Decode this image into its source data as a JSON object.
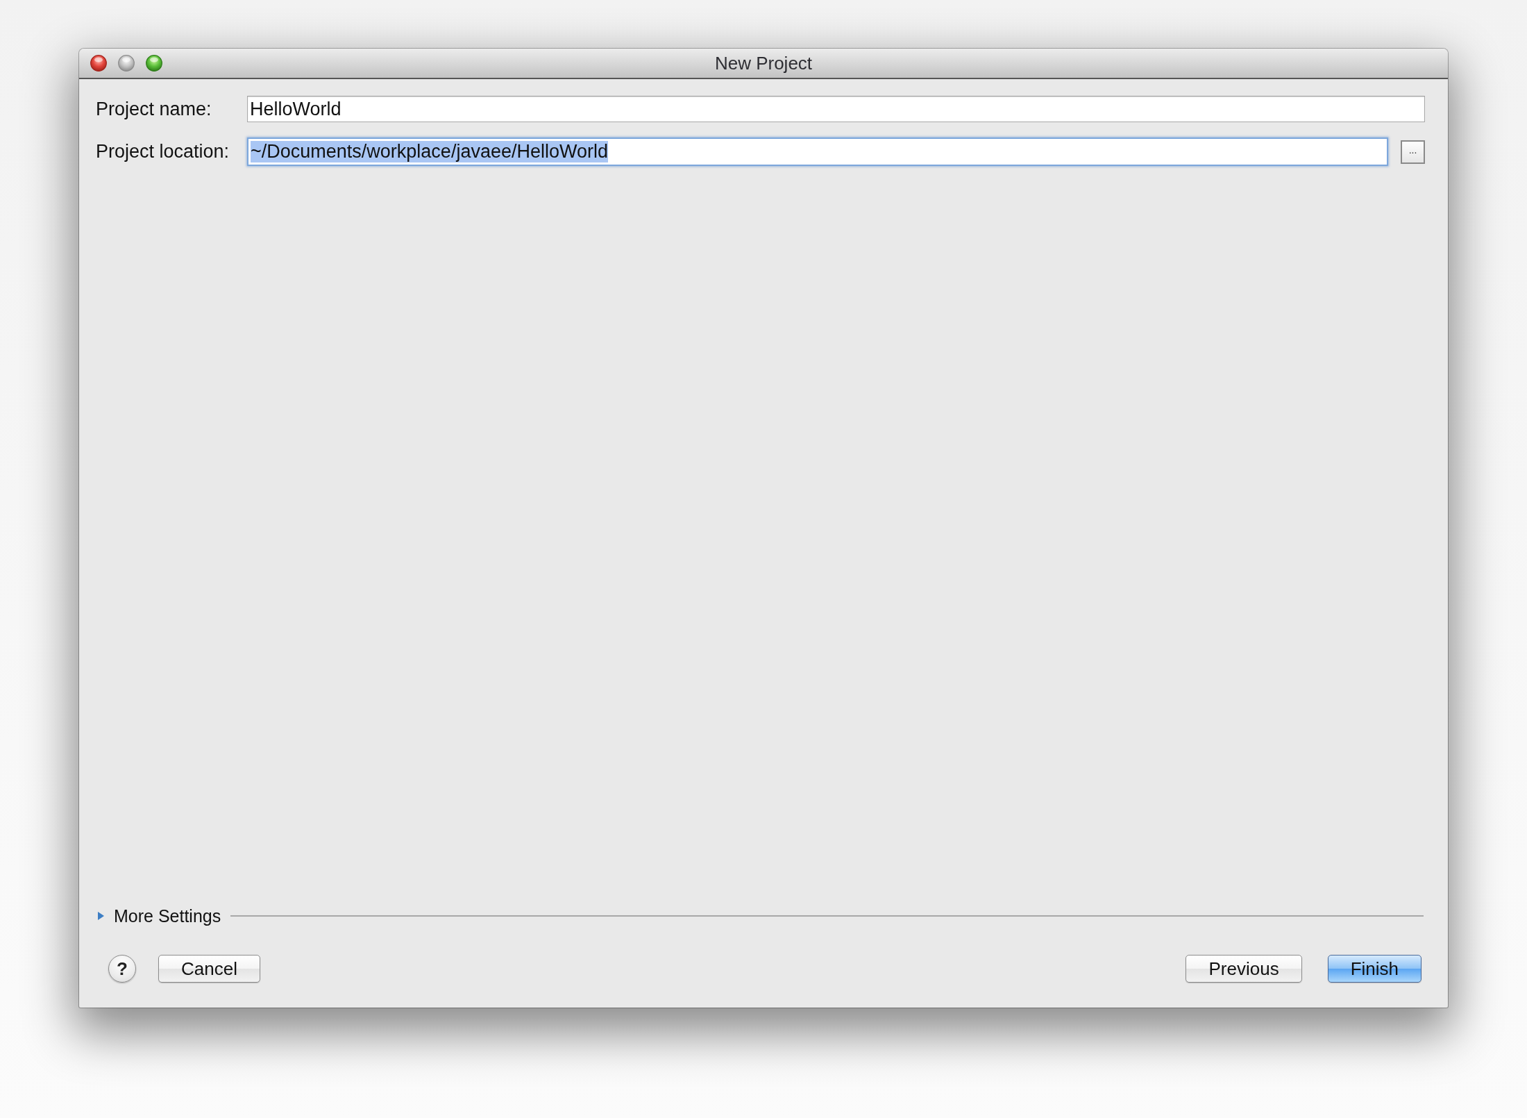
{
  "window": {
    "title": "New Project",
    "buttons": [
      {
        "kind": "close",
        "disabled": false
      },
      {
        "kind": "minimize",
        "disabled": true
      },
      {
        "kind": "zoom",
        "disabled": false
      }
    ]
  },
  "form": {
    "fields": [
      {
        "label": "Project name:",
        "value": "HelloWorld",
        "focused": false,
        "text_selected": false
      },
      {
        "label": "Project location:",
        "value": "~/Documents/workplace/javaee/HelloWorld",
        "focused": true,
        "text_selected": true,
        "browse_button": "..."
      }
    ]
  },
  "more_settings": {
    "label": "More Settings",
    "expanded": false
  },
  "footer": {
    "help": "?",
    "left": [
      {
        "label": "Cancel",
        "default": false
      }
    ],
    "right": [
      {
        "label": "Previous",
        "default": false
      },
      {
        "label": "Finish",
        "default": true
      }
    ]
  }
}
